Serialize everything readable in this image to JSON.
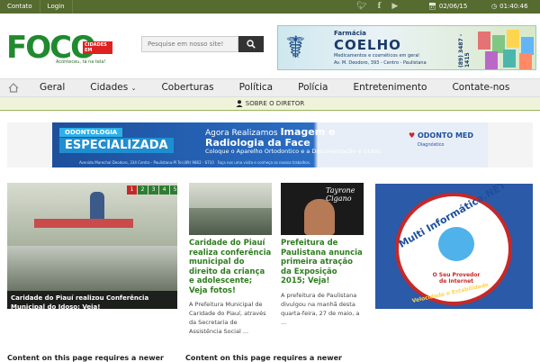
{
  "topbar": {
    "links": [
      "Contato",
      "Login"
    ],
    "date": "02/06/15",
    "time": "01:40:46"
  },
  "logo": {
    "word": "FOCO",
    "badge": "CIDADES EM",
    "tagline": "Aconteceu, tá na tela!"
  },
  "search": {
    "placeholder": "Pesquise em nosso site!"
  },
  "ad_top": {
    "line1": "Farmácia",
    "line2": "COELHO",
    "line3": "Medicamentos e cosméticos em geral",
    "line4": "Av. M. Deodoro, 393 - Centro - Paulistana",
    "phone": "(89) 3487 - 1415"
  },
  "nav": {
    "items": [
      "Geral",
      "Cidades",
      "Coberturas",
      "Política",
      "Polícia",
      "Entretenimento",
      "Contate-nos"
    ]
  },
  "subbar": {
    "label": "SOBRE O DIRETOR"
  },
  "big_ad": {
    "badge1": "ODONTOLOGIA",
    "badge2": "ESPECIALIZADA",
    "agora": "Agora Realizamos",
    "imagem": "Imagem e",
    "radiologia": "Radiologia da Face",
    "coloque": "Coloque o Aparelho Ortodontico e a Documentação é Grátis.",
    "address": "Avenida Marechal Deodoro, 334 Centro - Paulistana-PI    Tel.(89) 9862 - 6710",
    "faca": "Faça nos uma visita e conheça os nossos trabalhos.",
    "brand": "ODONTO MED",
    "brand_sub": "Diagnóstico"
  },
  "slider": {
    "numbers": [
      "1",
      "2",
      "3",
      "4",
      "5"
    ],
    "active": "1",
    "caption": "Caridade do Piauí realizou Conferência Municipal do Idoso; Veja!"
  },
  "cards": [
    {
      "title": "Caridade do Piauí realiza conferência municipal do direito da criança e adolescente; Veja fotos!",
      "desc": "A Prefeitura Municipal de Caridade do Piauí, através da Secretaria de Assistência Social ..."
    },
    {
      "title": "Prefeitura de Paulistana anuncia primeira atração da Exposição 2015; Veja!",
      "desc": "A prefeitura de Paulistana divulgou na manhã desta quarta-feira, 27 de maio, a ...",
      "overlay": "Tayrone Cigano"
    }
  ],
  "right_ad": {
    "title": "Multi Informática.NET",
    "slogan": "O Seu Provedor de Internet",
    "tagline": "Velocidade e Estabilidade"
  },
  "footer": {
    "left": "Content on this page requires a newer",
    "right": "Content on this page requires a newer"
  },
  "colors": {
    "topbar": "#556b2f",
    "accent_green": "#2e7d1f",
    "nav_bg": "#eeeeee"
  }
}
